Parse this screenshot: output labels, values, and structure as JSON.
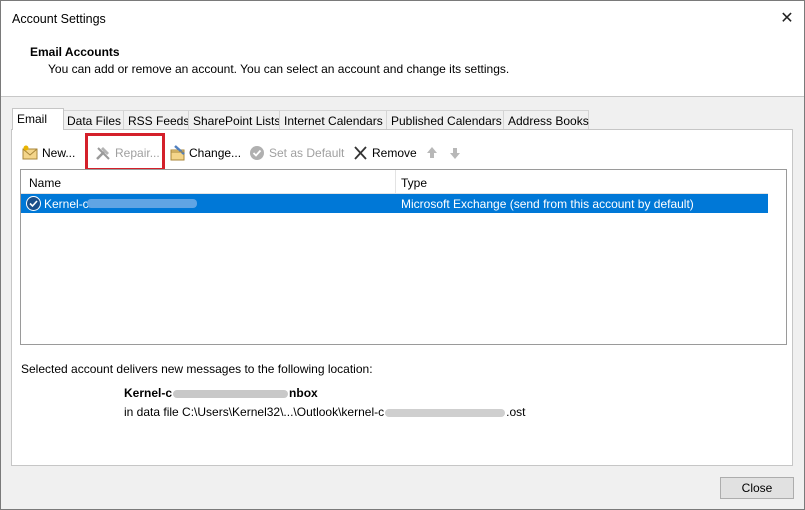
{
  "window": {
    "title": "Account Settings"
  },
  "header": {
    "title": "Email Accounts",
    "description": "You can add or remove an account. You can select an account and change its settings."
  },
  "tabs": [
    {
      "label": "Email",
      "active": true
    },
    {
      "label": "Data Files"
    },
    {
      "label": "RSS Feeds"
    },
    {
      "label": "SharePoint Lists"
    },
    {
      "label": "Internet Calendars"
    },
    {
      "label": "Published Calendars"
    },
    {
      "label": "Address Books"
    }
  ],
  "toolbar": {
    "new_label": "New...",
    "repair_label": "Repair...",
    "change_label": "Change...",
    "default_label": "Set as Default",
    "remove_label": "Remove"
  },
  "list": {
    "columns": {
      "name": "Name",
      "type": "Type"
    },
    "rows": [
      {
        "name": "Kernel-c",
        "type": "Microsoft Exchange (send from this account by default)"
      }
    ]
  },
  "delivery": {
    "label": "Selected account delivers new messages to the following location:",
    "name_prefix": "Kernel-c",
    "name_suffix": "nbox",
    "path_prefix": "in data file C:\\Users\\Kernel32\\...\\Outlook\\kernel-c",
    "path_suffix": ".ost"
  },
  "footer": {
    "close_label": "Close"
  }
}
